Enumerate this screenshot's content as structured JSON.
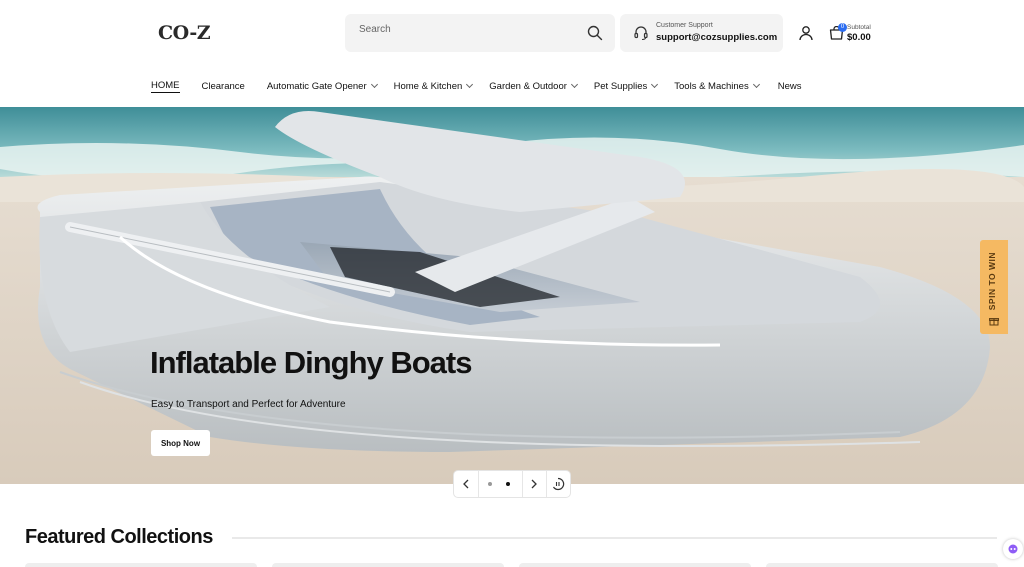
{
  "header": {
    "logo": "CO-Z",
    "search_placeholder": "Search",
    "support_label": "Customer Support",
    "support_email": "support@cozsupplies.com",
    "cart_count": "0",
    "subtotal_label": "Subtotal",
    "subtotal_value": "$0.00"
  },
  "nav": [
    {
      "label": "HOME",
      "dropdown": false,
      "active": true
    },
    {
      "label": "Clearance",
      "dropdown": false
    },
    {
      "label": "Automatic Gate Opener",
      "dropdown": true
    },
    {
      "label": "Home & Kitchen",
      "dropdown": true
    },
    {
      "label": "Garden & Outdoor",
      "dropdown": true
    },
    {
      "label": "Pet Supplies",
      "dropdown": true
    },
    {
      "label": "Tools & Machines",
      "dropdown": true
    },
    {
      "label": "News",
      "dropdown": false
    }
  ],
  "hero": {
    "title": "Inflatable Dinghy Boats",
    "subtitle": "Easy to Transport and Perfect for Adventure",
    "button": "Shop Now"
  },
  "spin_widget": {
    "label": "SPIN TO WIN"
  },
  "slider": {
    "slide_count": 2,
    "active_index": 1
  },
  "featured": {
    "title": "Featured Collections"
  },
  "icons": [
    "search-icon",
    "headset-icon",
    "account-icon",
    "cart-icon",
    "chevron-left-icon",
    "chevron-right-icon",
    "pause-icon",
    "chat-icon",
    "gift-icon"
  ],
  "colors": {
    "accent": "#2b6cf0",
    "spin_bg": "#f5b962"
  }
}
